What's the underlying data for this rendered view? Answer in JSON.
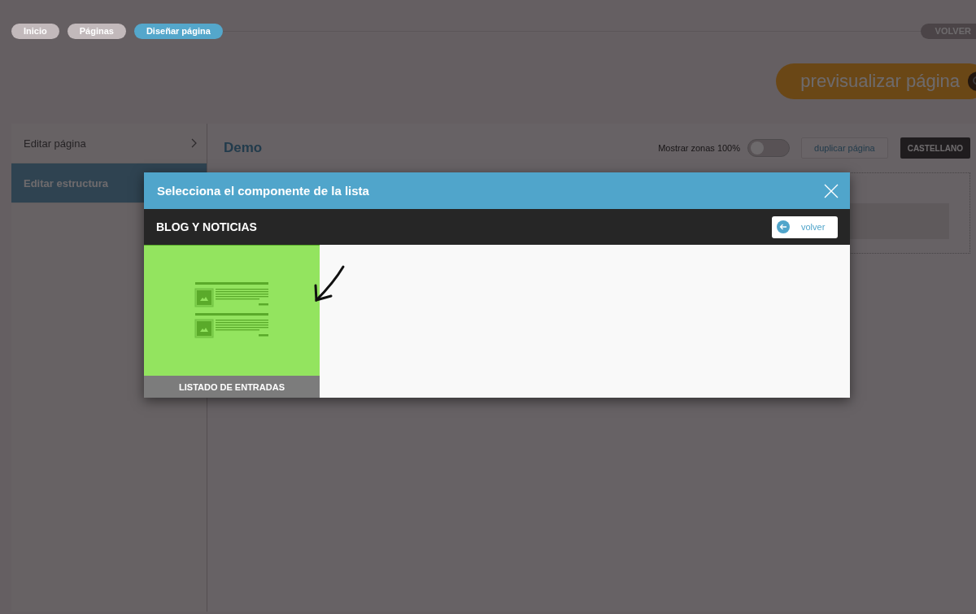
{
  "breadcrumbs": [
    {
      "label": "Inicio",
      "selected": false
    },
    {
      "label": "Páginas",
      "selected": false
    },
    {
      "label": "Diseñar página",
      "selected": true
    }
  ],
  "back_button": "VOLVER",
  "preview_button": "previsualizar página",
  "sidebar": {
    "items": [
      {
        "label": "Editar página",
        "selected": false
      },
      {
        "label": "Editar estructura",
        "selected": true
      }
    ]
  },
  "page": {
    "title": "Demo",
    "toggle": {
      "label": "Mostrar zonas 100%",
      "on": false
    },
    "duplicate_button": "duplicar página",
    "language_button": "CASTELLANO"
  },
  "modal": {
    "title": "Selecciona el componente de la lista",
    "category": "BLOG Y NOTICIAS",
    "back_button": "volver",
    "components": [
      {
        "label": "LISTADO DE ENTRADAS"
      }
    ]
  }
}
